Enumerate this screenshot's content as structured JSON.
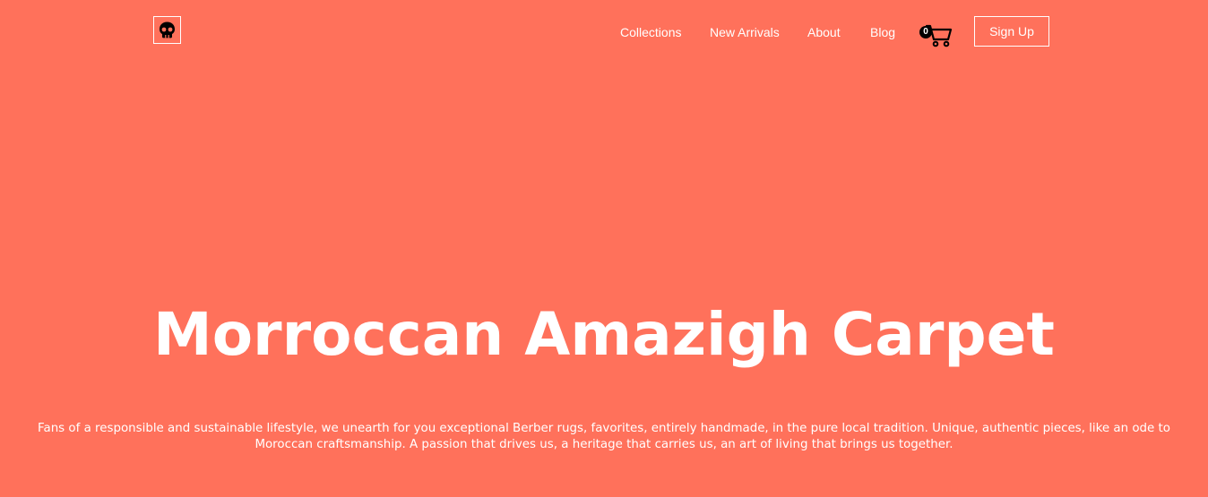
{
  "header": {
    "logo_icon": "skull-icon",
    "nav": {
      "collections": "Collections",
      "new_arrivals": "New Arrivals",
      "about": "About",
      "blog": "Blog"
    },
    "cart": {
      "icon": "shopping-cart-icon",
      "count": "0"
    },
    "signup_label": "Sign Up"
  },
  "hero": {
    "title": "Morroccan Amazigh Carpet",
    "description": "Fans of a responsible and sustainable lifestyle, we unearth for you exceptional Berber rugs, favorites, entirely handmade, in the pure local tradition. Unique, authentic pieces, like an ode to Moroccan craftsmanship. A passion that drives us, a heritage that carries us, an art of living that brings us together."
  },
  "colors": {
    "background": "#ff715b",
    "text": "#ffffff",
    "icon": "#000000"
  }
}
